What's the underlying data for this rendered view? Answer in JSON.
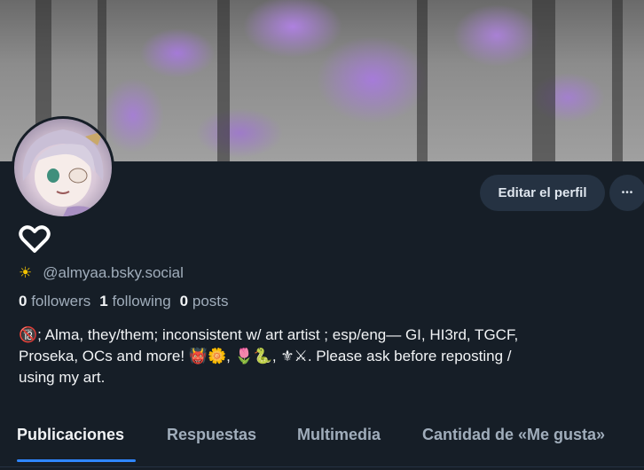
{
  "profile": {
    "edit_label": "Editar el perfil",
    "more_label": "•••",
    "handle_emoji": "☀",
    "handle": "@almyaa.bsky.social",
    "stats": {
      "followers_count": "0",
      "followers_label": "followers",
      "following_count": "1",
      "following_label": "following",
      "posts_count": "0",
      "posts_label": "posts"
    },
    "bio_line1": "🔞; Alma, they/them; inconsistent w/ art artist ; esp/eng— GI, HI3rd, TGCF,",
    "bio_line2": "Proseka, OCs and more! 👹🌼, 🌷🐍, ⚜⚔. Please ask before reposting /",
    "bio_line3": "using my art."
  },
  "tabs": [
    {
      "label": "Publicaciones"
    },
    {
      "label": "Respuestas"
    },
    {
      "label": "Multimedia"
    },
    {
      "label": "Cantidad de «Me gusta»"
    }
  ],
  "colors": {
    "background": "#161e27",
    "button_bg": "#253242",
    "accent": "#2f86ff",
    "muted_text": "#a0adbb"
  }
}
